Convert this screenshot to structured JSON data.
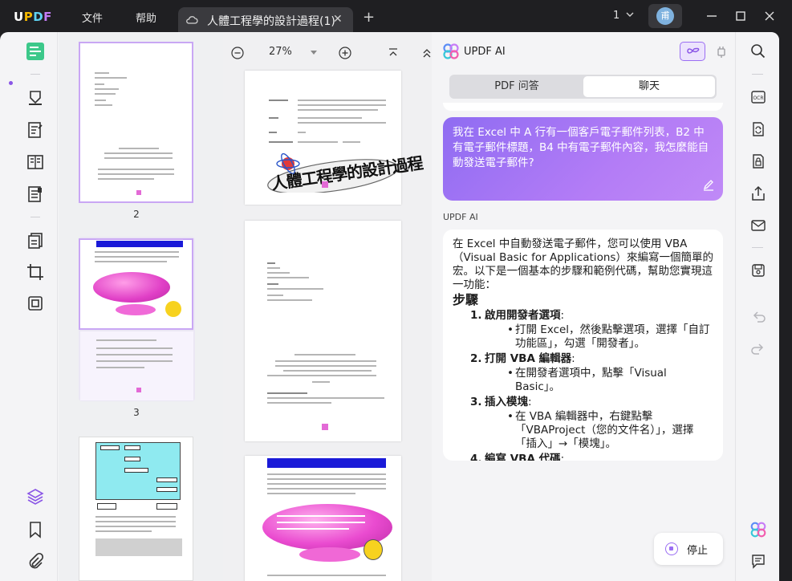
{
  "app": {
    "logo": "UPDF",
    "menu": [
      "文件",
      "帮助"
    ],
    "tab_title": "人體工程學的設計過程(1)",
    "page_indicator": "1",
    "avatar_initial": "甫"
  },
  "thumbnails": [
    {
      "label": "2"
    },
    {
      "label": "3"
    }
  ],
  "doc_toolbar": {
    "zoom": "27%"
  },
  "doc_page1": {
    "banner": "人體工程學的設計過程"
  },
  "ai": {
    "title": "UPDF AI",
    "tabs": [
      "PDF 问答",
      "聊天"
    ],
    "active_tab": 1,
    "user_message": "我在 Excel 中 A 行有一個客戶電子郵件列表，B2 中有電子郵件標題，B4 中有電子郵件內容，我怎麼能自動發送電子郵件?",
    "assistant_label": "UPDF AI",
    "answer": {
      "intro": "在 Excel 中自動發送電子郵件，您可以使用 VBA（Visual Basic for Applications）來編寫一個簡單的宏。以下是一個基本的步驟和範例代碼，幫助您實現這一功能：",
      "heading": "步驟",
      "steps": [
        {
          "num": "1.",
          "title": "啟用開發者選項",
          "colon": ":",
          "bullets": [
            "打開 Excel，然後點擊選項，選擇「自訂功能區」，勾選「開發者」。"
          ]
        },
        {
          "num": "2.",
          "title": "打開 VBA 編輯器",
          "colon": ":",
          "bullets": [
            "在開發者選項中，點擊「Visual Basic」。"
          ]
        },
        {
          "num": "3.",
          "title": "插入模塊",
          "colon": ":",
          "bullets": [
            "在 VBA 編輯器中，右鍵點擊「VBAProject（您的文件名）」，選擇「插入」→「模塊」。"
          ]
        },
        {
          "num": "4.",
          "title": "編寫 VBA 代碼",
          "colon": ":",
          "bullets": []
        }
      ]
    },
    "stop_label": "停止"
  },
  "colors": {
    "accent": "#9b6ef3",
    "bubble_start": "#8f6cf2",
    "bubble_end": "#c08af7",
    "titlebar": "#1f1f22"
  },
  "icons": {
    "rail": [
      "reader-icon",
      "comment-icon",
      "edit-text-icon",
      "page-layout-icon",
      "form-icon",
      "organize-pages-icon",
      "crop-icon",
      "compress-icon",
      "layers-icon",
      "bookmark-icon",
      "attachment-icon"
    ],
    "right": [
      "search-icon",
      "ocr-icon",
      "convert-icon",
      "protect-icon",
      "share-icon",
      "email-icon",
      "save-icon",
      "undo-icon",
      "redo-icon",
      "updf-ai-icon",
      "chat-icon"
    ]
  }
}
